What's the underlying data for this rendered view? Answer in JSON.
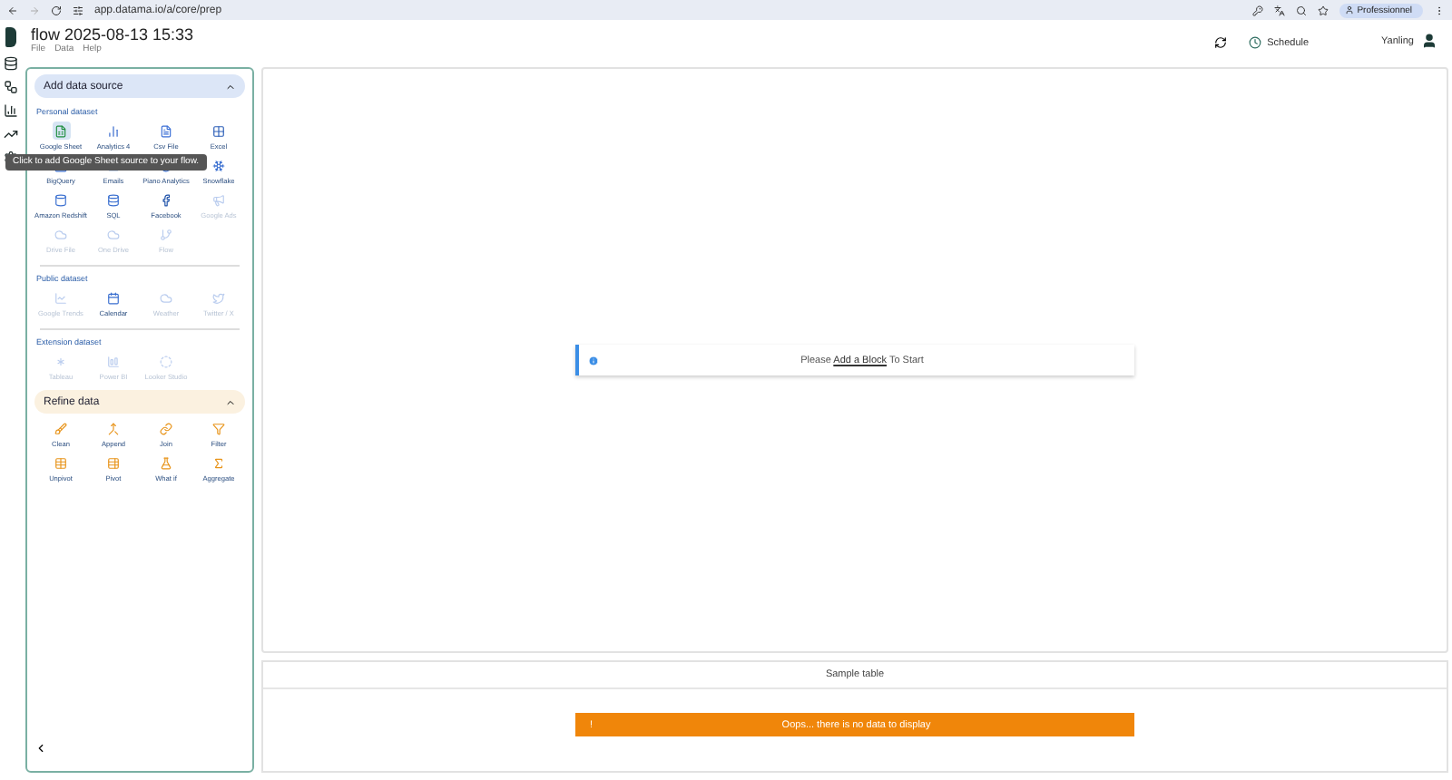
{
  "browser": {
    "url": "app.datama.io/a/core/prep",
    "profile": "Professionnel"
  },
  "app": {
    "title": "flow 2025-08-13 15:33",
    "menu": [
      "File",
      "Data",
      "Help"
    ],
    "schedule": "Schedule",
    "user": "Yanling"
  },
  "sidebar": {
    "sections": [
      {
        "kind": "source",
        "title": "Add data source",
        "expanded": true,
        "groups": [
          {
            "title": "Personal dataset",
            "items": [
              {
                "label": "Google Sheet",
                "disabled": false,
                "hovered": true
              },
              {
                "label": "Analytics 4",
                "disabled": false,
                "hovered": false
              },
              {
                "label": "Csv File",
                "disabled": false,
                "hovered": false
              },
              {
                "label": "Excel",
                "disabled": false,
                "hovered": false
              },
              {
                "label": "BigQuery",
                "disabled": false,
                "hovered": false
              },
              {
                "label": "Emails",
                "disabled": false,
                "hovered": false
              },
              {
                "label": "Piano Analytics",
                "disabled": false,
                "hovered": false
              },
              {
                "label": "Snowflake",
                "disabled": false,
                "hovered": false
              },
              {
                "label": "Amazon Redshift",
                "disabled": false,
                "hovered": false
              },
              {
                "label": "SQL",
                "disabled": false,
                "hovered": false
              },
              {
                "label": "Facebook",
                "disabled": false,
                "hovered": false
              },
              {
                "label": "Google Ads",
                "disabled": true,
                "hovered": false
              },
              {
                "label": "Drive File",
                "disabled": true,
                "hovered": false
              },
              {
                "label": "One Drive",
                "disabled": true,
                "hovered": false
              },
              {
                "label": "Flow",
                "disabled": true,
                "hovered": false
              }
            ]
          },
          {
            "title": "Public dataset",
            "items": [
              {
                "label": "Google Trends",
                "disabled": true,
                "hovered": false
              },
              {
                "label": "Calendar",
                "disabled": false,
                "hovered": false
              },
              {
                "label": "Weather",
                "disabled": true,
                "hovered": false
              },
              {
                "label": "Twitter / X",
                "disabled": true,
                "hovered": false
              }
            ]
          },
          {
            "title": "Extension dataset",
            "items": [
              {
                "label": "Tableau",
                "disabled": true,
                "hovered": false
              },
              {
                "label": "Power BI",
                "disabled": true,
                "hovered": false
              },
              {
                "label": "Looker Studio",
                "disabled": true,
                "hovered": false
              }
            ]
          }
        ]
      },
      {
        "kind": "refine",
        "title": "Refine data",
        "expanded": true,
        "groups": [
          {
            "items": [
              {
                "label": "Clean",
                "disabled": false,
                "hovered": false
              },
              {
                "label": "Append",
                "disabled": false,
                "hovered": false
              },
              {
                "label": "Join",
                "disabled": false,
                "hovered": false
              },
              {
                "label": "Filter",
                "disabled": false,
                "hovered": false
              },
              {
                "label": "Unpivot",
                "disabled": false,
                "hovered": false
              },
              {
                "label": "Pivot",
                "disabled": false,
                "hovered": false
              },
              {
                "label": "What if",
                "disabled": false,
                "hovered": false
              },
              {
                "label": "Aggregate",
                "disabled": false,
                "hovered": false
              }
            ]
          }
        ]
      }
    ]
  },
  "tooltip": "Click to add Google Sheet source to your flow.",
  "canvas": {
    "message": {
      "before": "Please",
      "link": "Add a Block",
      "after": "To Start"
    }
  },
  "sample_table": {
    "title": "Sample table",
    "alert": {
      "icon": "!",
      "text": "Oops... there is no data to display"
    }
  }
}
